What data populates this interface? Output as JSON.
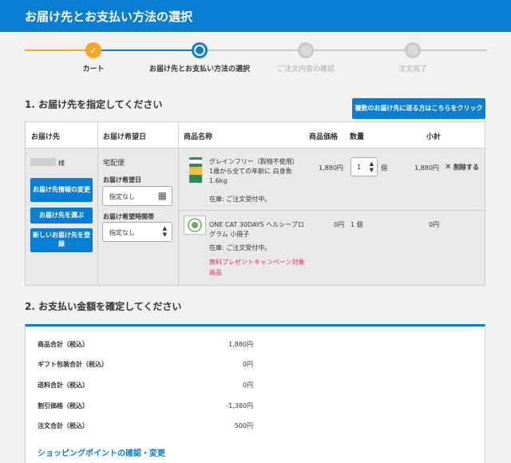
{
  "header": {
    "title": "お届け先とお支払い方法の選択"
  },
  "steps": [
    {
      "label": "カート",
      "state": "done",
      "check": "✓"
    },
    {
      "label": "お届け先とお支払い方法の選択",
      "state": "current"
    },
    {
      "label": "ご注文内容の確認",
      "state": "pending"
    },
    {
      "label": "注文完了",
      "state": "pending"
    }
  ],
  "delivery": {
    "title": "1. お届け先を指定してください",
    "multi_button": "複数のお届け先に送る方はこちらをクリック",
    "columns": [
      "お届け先",
      "お届け希望日",
      "商品名称",
      "商品価格",
      "数量",
      "小計"
    ],
    "recipient_suffix": "様",
    "buttons": {
      "change": "お届け先情報の変更",
      "select": "お届け先を選ぶ",
      "new": "新しいお届け先を登録"
    },
    "shipping_method": "宅配便",
    "date_label": "お届け希望日",
    "date_value": "指定なし",
    "time_label": "お届け希望時間帯",
    "time_value": "指定なし",
    "items": [
      {
        "name": "グレインフリー（穀物不使用）1歳から全ての年齢に 白身魚 1.6kg",
        "stock": "在庫: ご注文受付中。",
        "price": "1,880円",
        "qty": "1",
        "qty_unit": "個",
        "subtotal": "1,880円",
        "delete": "削除する"
      },
      {
        "name": "ONE CAT 30DAYS ヘルシープログラム 小冊子",
        "stock": "在庫: ご注文受付中。",
        "campaign": "無料プレゼントキャンペーン対象商品",
        "price": "0円",
        "qty": "1 個",
        "subtotal": "0円"
      }
    ]
  },
  "payment": {
    "title": "2. お支払い金額を確定してください",
    "rows": [
      {
        "label": "商品合計（税込）",
        "value": "1,880円"
      },
      {
        "label": "ギフト包装合計（税込）",
        "value": "0円"
      },
      {
        "label": "送料合計（税込）",
        "value": "0円"
      },
      {
        "label": "割引価格（税込）",
        "value": "-1,380円"
      },
      {
        "label": "注文合計（税込）",
        "value": "500円"
      }
    ],
    "points_link": "ショッピングポイントの確認・変更"
  },
  "colors": {
    "primary": "#0a7ed2",
    "accent": "#f5a623",
    "campaign": "#e0325a"
  }
}
